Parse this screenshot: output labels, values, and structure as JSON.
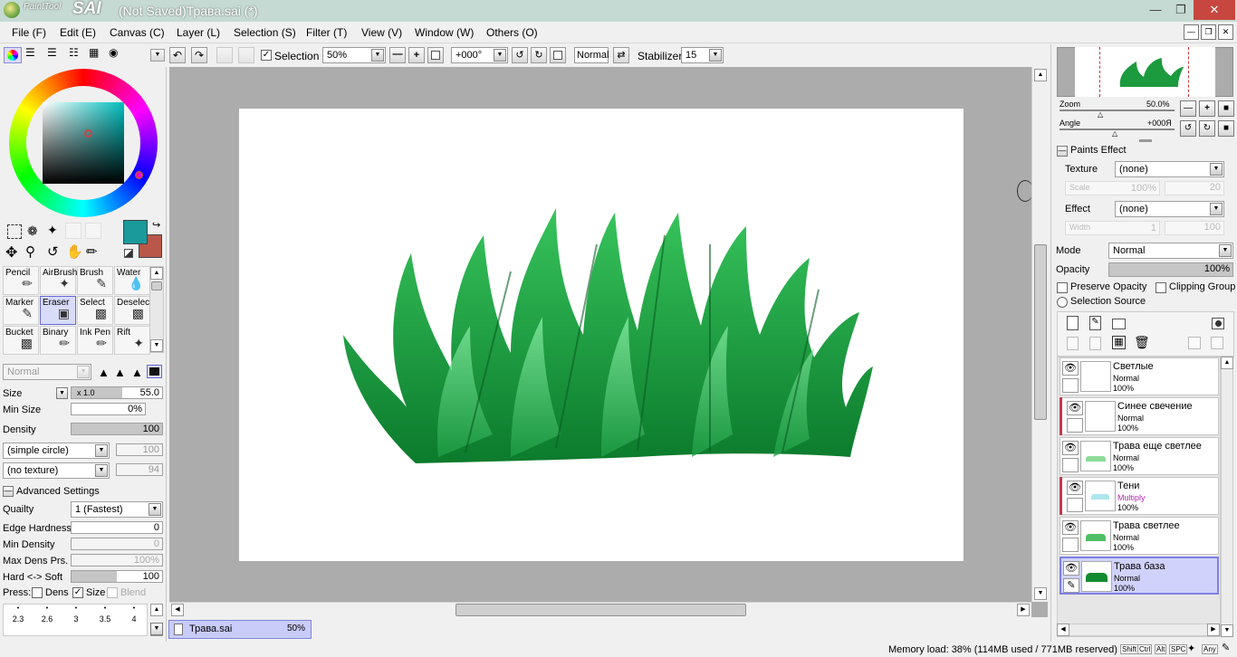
{
  "app": {
    "logo_small": "PaintTool",
    "logo_big": "SAI",
    "window_title": "(Not Saved)Трава.sai (*)"
  },
  "menu": [
    "File (F)",
    "Edit (E)",
    "Canvas (C)",
    "Layer (L)",
    "Selection (S)",
    "Filter (T)",
    "View (V)",
    "Window (W)",
    "Others (O)"
  ],
  "toolbar": {
    "selection_label": "Selection",
    "selection_checked": true,
    "zoom_value": "50%",
    "angle_value": "+000°",
    "blend_mode": "Normal",
    "stabilizer_label": "Stabilizer",
    "stabilizer_value": "15"
  },
  "tools": [
    {
      "label": "Pencil",
      "icon": "pencil-icon"
    },
    {
      "label": "AirBrush",
      "icon": "airbrush-icon"
    },
    {
      "label": "Brush",
      "icon": "brush-icon"
    },
    {
      "label": "Water",
      "icon": "water-icon"
    },
    {
      "label": "Marker",
      "icon": "marker-icon"
    },
    {
      "label": "Eraser",
      "icon": "eraser-icon",
      "selected": true
    },
    {
      "label": "Select",
      "icon": "select-icon"
    },
    {
      "label": "Deselect",
      "icon": "deselect-icon"
    },
    {
      "label": "Bucket",
      "icon": "bucket-icon"
    },
    {
      "label": "Binary",
      "icon": "binary-icon"
    },
    {
      "label": "Ink Pen",
      "icon": "ink-pen-icon"
    },
    {
      "label": "Rift",
      "icon": "rift-icon"
    }
  ],
  "colors": {
    "primary": "#1a9a9b",
    "secondary": "#b9584a",
    "accent": "#7f85d6"
  },
  "brush": {
    "mode": "Normal",
    "size_label": "Size",
    "size_mult": "x 1.0",
    "size_value": "55.0",
    "min_size_label": "Min Size",
    "min_size_value": "0%",
    "density_label": "Density",
    "density_value": "100",
    "shape": "(simple circle)",
    "shape_value": "100",
    "texture": "(no texture)",
    "texture_value": "94",
    "advanced_label": "Advanced Settings",
    "quality_label": "Quailty",
    "quality_value": "1 (Fastest)",
    "edge_label": "Edge Hardness",
    "edge_value": "0",
    "min_density_label": "Min Density",
    "min_density_value": "0",
    "max_dens_label": "Max Dens Prs.",
    "max_dens_value": "100%",
    "hard_soft_label": "Hard <-> Soft",
    "hard_soft_value": "100",
    "press_label": "Press:",
    "press_dens": "Dens",
    "press_size": "Size",
    "press_blend": "Blend",
    "presets": [
      "2.3",
      "2.6",
      "3",
      "3.5",
      "4"
    ]
  },
  "file_tab": {
    "name": "Трава.sai",
    "zoom": "50%"
  },
  "status": {
    "memory": "Memory load: 38% (114MB used / 771MB reserved)",
    "keys": [
      "Shift",
      "Ctrl",
      "Alt",
      "SPC",
      "Any"
    ]
  },
  "navigator": {
    "zoom_label": "Zoom",
    "zoom_value": "50.0%",
    "angle_label": "Angle",
    "angle_value": "+000Я"
  },
  "paints_effect": {
    "header": "Paints Effect",
    "texture_label": "Texture",
    "texture_value": "(none)",
    "scale_label": "Scale",
    "scale_value": "100%",
    "scale_num": "20",
    "effect_label": "Effect",
    "effect_value": "(none)",
    "width_label": "Width",
    "width_value": "1",
    "width_num": "100"
  },
  "layer_props": {
    "mode_label": "Mode",
    "mode_value": "Normal",
    "opacity_label": "Opacity",
    "opacity_value": "100%",
    "preserve_label": "Preserve Opacity",
    "clipping_label": "Clipping Group",
    "selection_source_label": "Selection Source"
  },
  "layers": [
    {
      "name": "Светлые",
      "mode": "Normal",
      "opacity": "100%",
      "clip": false,
      "selected": false,
      "mode_color": "#000000"
    },
    {
      "name": "Синее свечение",
      "mode": "Normal",
      "opacity": "100%",
      "clip": true,
      "selected": false,
      "mode_color": "#000000"
    },
    {
      "name": "Трава еще светлее",
      "mode": "Normal",
      "opacity": "100%",
      "clip": false,
      "selected": false,
      "mode_color": "#000000"
    },
    {
      "name": "Тени",
      "mode": "Multiply",
      "opacity": "100%",
      "clip": true,
      "selected": false,
      "mode_color": "#b02bb0"
    },
    {
      "name": "Трава светлее",
      "mode": "Normal",
      "opacity": "100%",
      "clip": false,
      "selected": false,
      "mode_color": "#000000"
    },
    {
      "name": "Трава база",
      "mode": "Normal",
      "opacity": "100%",
      "clip": false,
      "selected": true,
      "mode_color": "#000000"
    }
  ]
}
